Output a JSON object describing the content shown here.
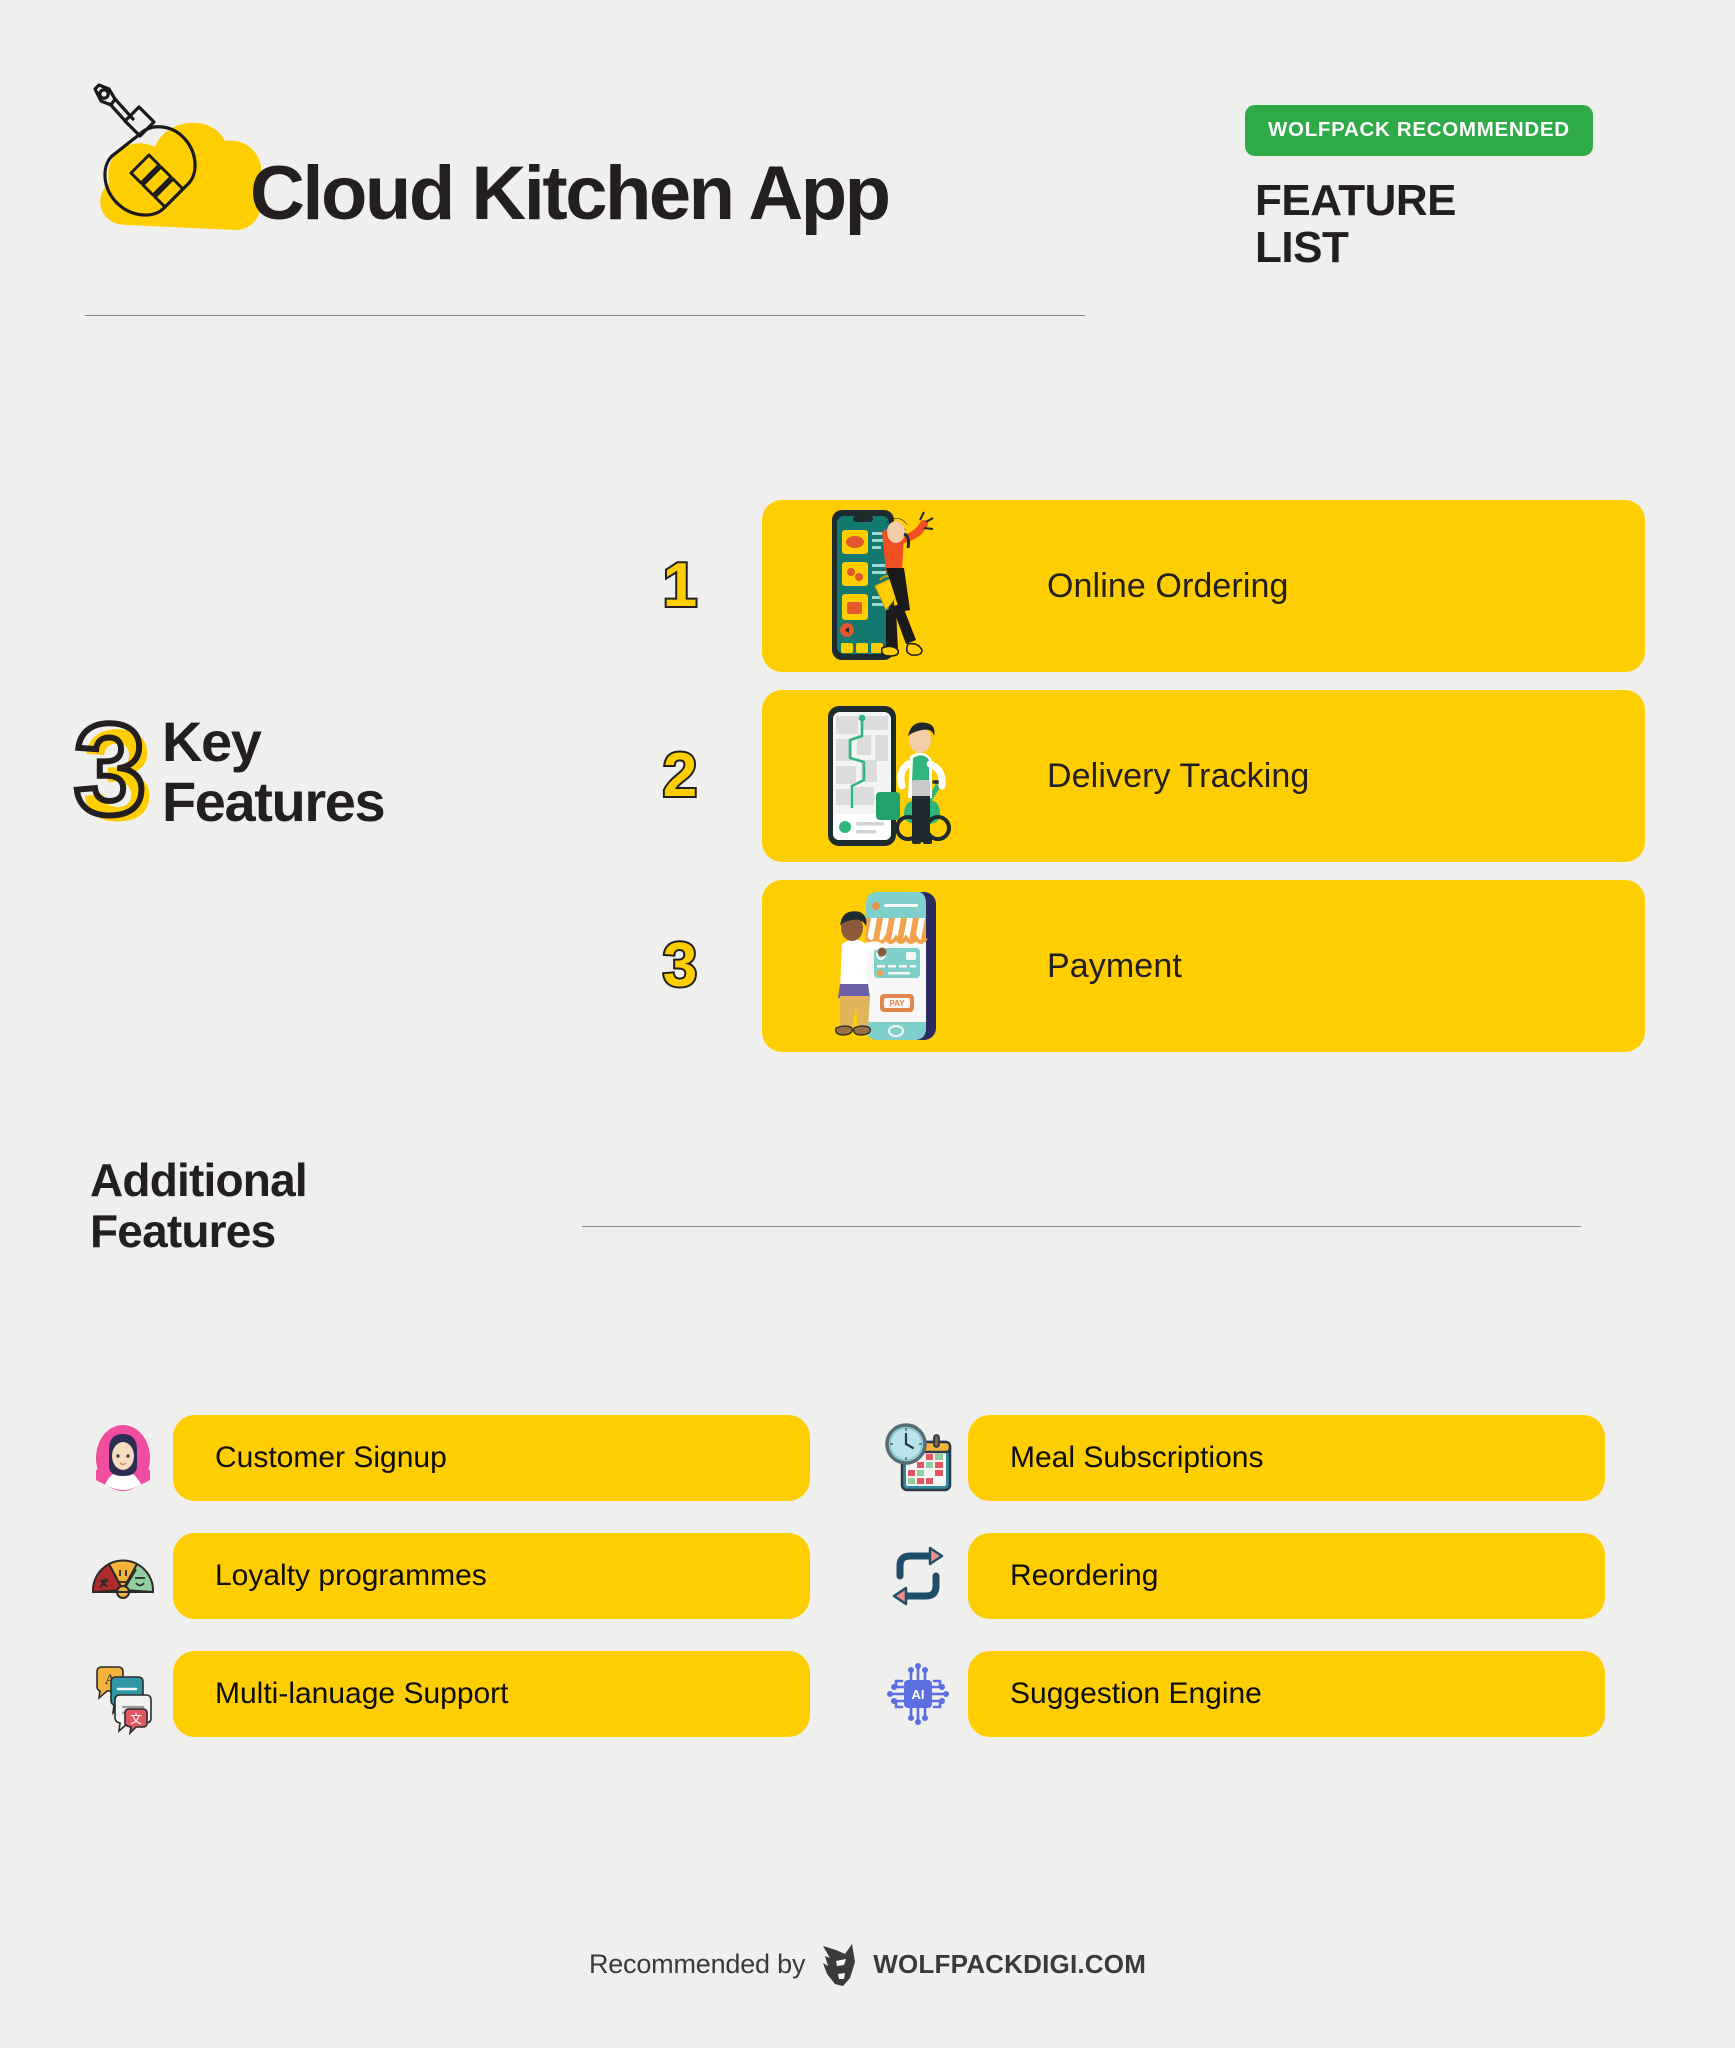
{
  "page": {
    "background_color": "#EFEFEE",
    "accent_yellow": "#FFCE00",
    "accent_green": "#2EAA47",
    "ink": "#231F20"
  },
  "header": {
    "title": "Cloud Kitchen App",
    "logo_icon": "spatula-cloud-icon",
    "badge": "WOLFPACK RECOMMENDED",
    "subtitle_line1": "FEATURE",
    "subtitle_line2": "LIST"
  },
  "key_features": {
    "heading_number": "3",
    "heading_line1": "Key",
    "heading_line2": "Features",
    "items": [
      {
        "number": "1",
        "label": "Online Ordering",
        "illustration": "phone-shopper-illustration"
      },
      {
        "number": "2",
        "label": "Delivery Tracking",
        "illustration": "phone-map-scooter-illustration"
      },
      {
        "number": "3",
        "label": "Payment",
        "illustration": "phone-storefront-card-illustration"
      }
    ]
  },
  "additional_features": {
    "heading_line1": "Additional",
    "heading_line2": "Features",
    "left_column": [
      {
        "label": "Customer Signup",
        "icon": "user-avatar-icon"
      },
      {
        "label": "Loyalty programmes",
        "icon": "satisfaction-gauge-icon"
      },
      {
        "label": "Multi-lanuage Support",
        "icon": "translate-chat-icon"
      }
    ],
    "right_column": [
      {
        "label": "Meal Subscriptions",
        "icon": "clock-calendar-icon"
      },
      {
        "label": "Reordering",
        "icon": "loop-arrows-icon"
      },
      {
        "label": "Suggestion Engine",
        "icon": "ai-chip-icon"
      }
    ]
  },
  "footer": {
    "prefix": "Recommended by",
    "logo_icon": "wolf-head-icon",
    "brand": "WOLFPACKDIGI.COM"
  }
}
